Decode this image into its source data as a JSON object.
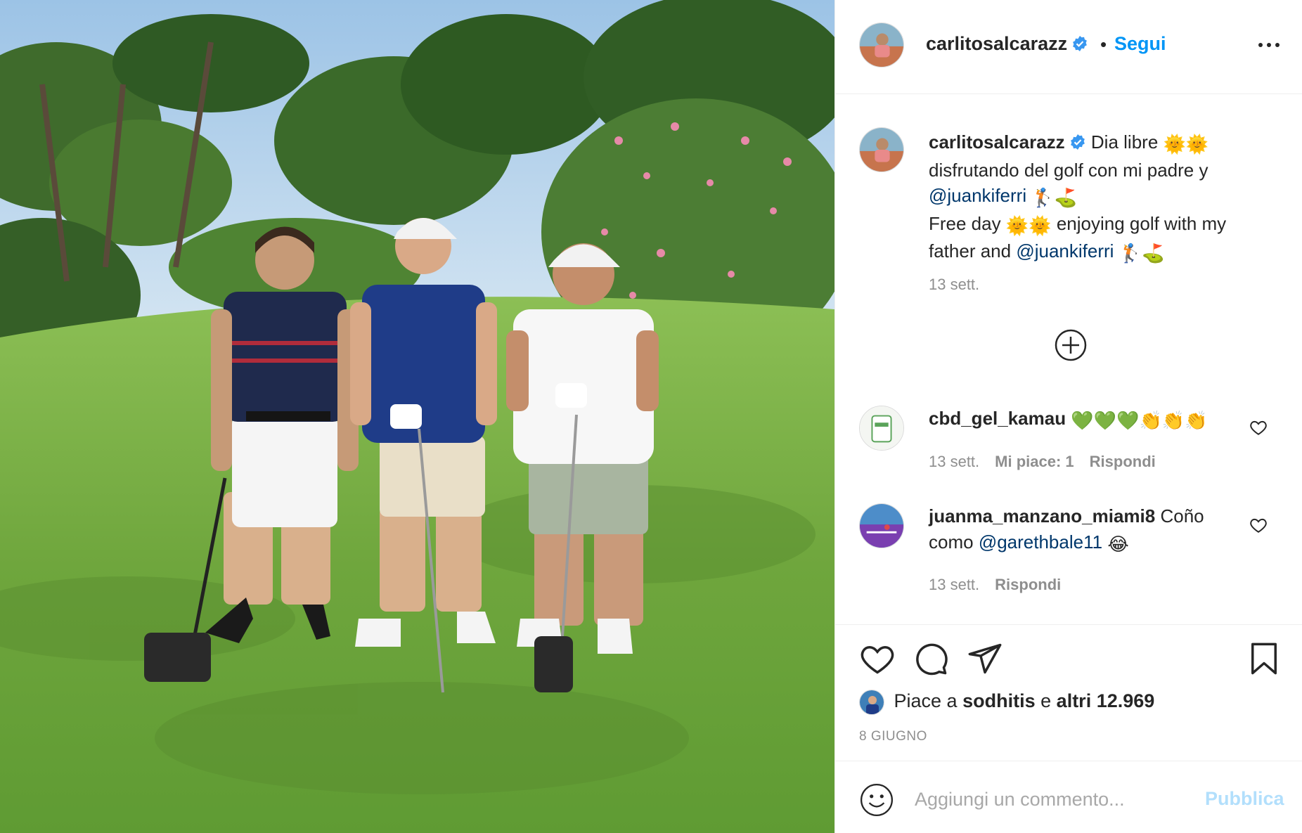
{
  "post": {
    "username": "carlitosalcarazz",
    "dot": "•",
    "follow_label": "Segui",
    "caption_user": "carlitosalcarazz",
    "caption_line1": "Dia libre",
    "caption_line2": "disfrutando del golf con mi padre y",
    "caption_mention1": "@juankiferri",
    "caption_line3": "Free day",
    "caption_line3b": "enjoying golf with my",
    "caption_line4": "father and",
    "caption_mention2": "@juankiferri",
    "caption_time": "13 sett."
  },
  "comments": [
    {
      "user": "cbd_gel_kamau",
      "text": "",
      "time": "13 sett.",
      "likes": "Mi piace: 1",
      "reply": "Rispondi"
    },
    {
      "user": "juanma_manzano_miami8",
      "text": "Coño",
      "text2": "como",
      "mention": "@garethbale11",
      "time": "13 sett.",
      "reply": "Rispondi"
    }
  ],
  "likes": {
    "prefix": "Piace a",
    "user": "sodhitis",
    "conj": "e",
    "others": "altri 12.969"
  },
  "date": "8 GIUGNO",
  "comment_box": {
    "placeholder": "Aggiungi un commento...",
    "publish_label": "Pubblica"
  },
  "colors": {
    "accent": "#0095f6",
    "publish_disabled": "#b2dffc",
    "mention": "#00376b",
    "muted": "#8e8e8e"
  },
  "icons": [
    "verified-badge-icon",
    "more-options-icon",
    "load-more-comments-icon",
    "heart-icon",
    "comment-icon",
    "share-icon",
    "bookmark-icon",
    "emoji-icon"
  ]
}
